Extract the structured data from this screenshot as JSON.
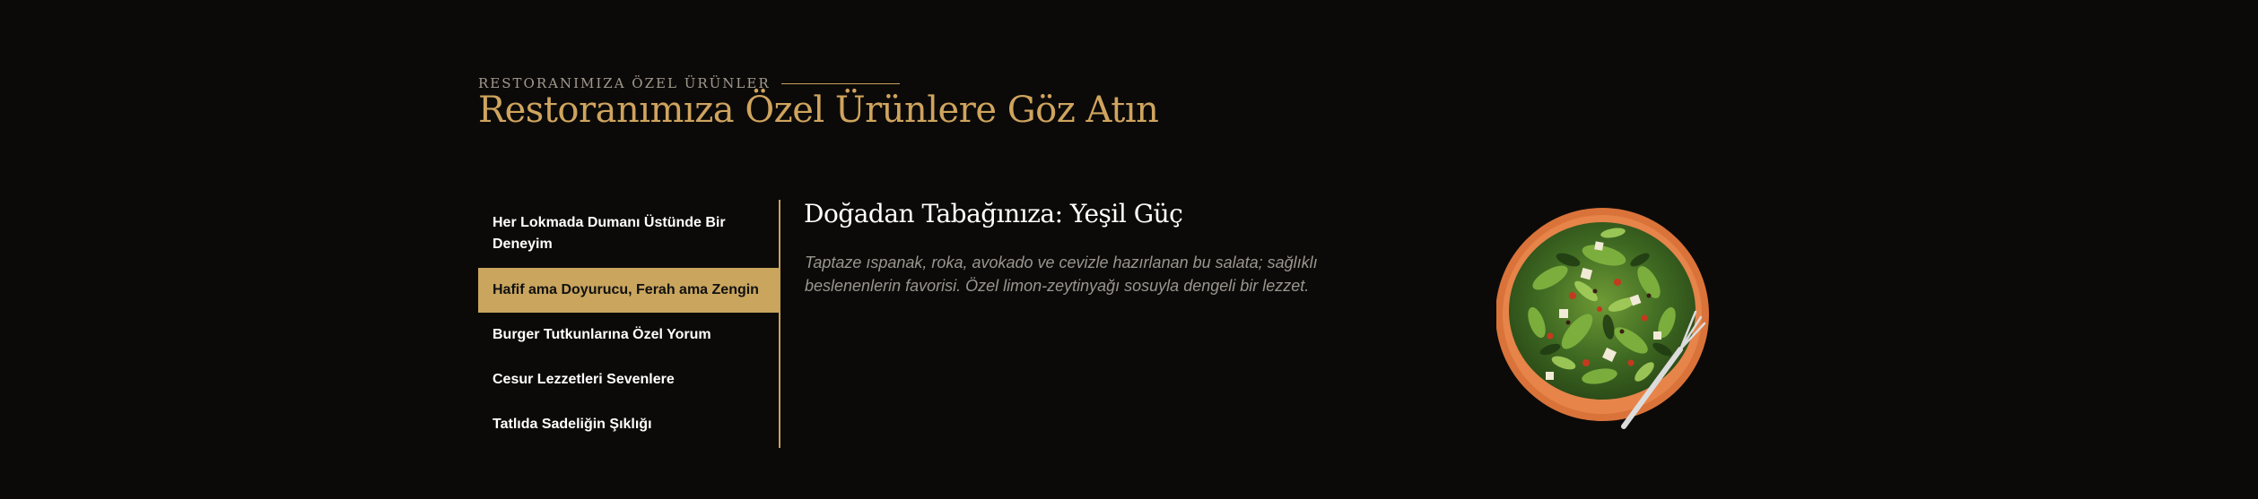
{
  "section": {
    "eyebrow": "RESTORANIMIZA ÖZEL ÜRÜNLER",
    "title": "Restoranımıza Özel Ürünlere Göz Atın"
  },
  "tabs": [
    {
      "label": "Her Lokmada Dumanı Üstünde Bir Deneyim",
      "active": false
    },
    {
      "label": "Hafif ama Doyurucu, Ferah ama Zengin",
      "active": true
    },
    {
      "label": "Burger Tutkunlarına Özel Yorum",
      "active": false
    },
    {
      "label": "Cesur Lezzetleri Sevenlere",
      "active": false
    },
    {
      "label": "Tatlıda Sadeliğin Şıklığı",
      "active": false
    }
  ],
  "content": {
    "title": "Doğadan Tabağınıza: Yeşil Güç",
    "description": "Taptaze ıspanak, roka, avokado ve cevizle hazırlanan bu salata; sağlıklı beslenenlerin favorisi. Özel limon-zeytinyağı sosuyla dengeli bir lezzet.",
    "image": "salad-bowl"
  },
  "colors": {
    "background": "#0c0a09",
    "accent": "#c9a55e",
    "heading": "#cfa45e"
  }
}
